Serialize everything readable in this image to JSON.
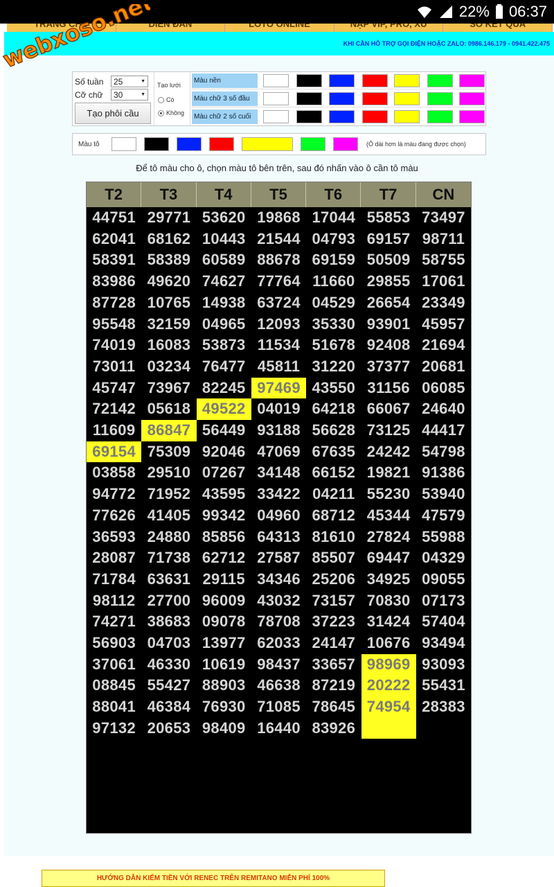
{
  "status_bar": {
    "battery": "22%",
    "time": "06:37",
    "wifi_icon": "wifi-icon",
    "signal_icon": "signal-icon",
    "battery_icon": "battery-icon"
  },
  "logo": {
    "text": "webxoso.net"
  },
  "nav": {
    "items": [
      "TRANG CHỦ",
      "DIỄN ĐÀN",
      "LOTO ONLINE",
      "NẠP VIP, PRO, XU",
      "SỔ KẾT QUẢ"
    ]
  },
  "support": {
    "text": "KHI CẦN HỖ TRỢ GỌI ĐIỆN HOẶC ZALO: 0986.146.179 - 0941.422.475"
  },
  "controls": {
    "so_tuan_label": "Số tuần",
    "so_tuan_value": "25",
    "co_chu_label": "Cỡ chữ",
    "co_chu_value": "30",
    "create_button": "Tạo phôi cầu",
    "grid_label": "Tạo lưới",
    "radio_yes": "Có",
    "radio_no": "Không",
    "rows": [
      {
        "label": "Màu nền"
      },
      {
        "label": "Màu chữ 3 số đầu"
      },
      {
        "label": "Màu chữ 2 số cuối"
      }
    ],
    "palette": [
      "#ffffff",
      "#000000",
      "#0022ff",
      "#ff0000",
      "#ffff00",
      "#00ff22",
      "#ff00ff"
    ]
  },
  "picker": {
    "label": "Màu tô",
    "colors": [
      "#ffffff",
      "#000000",
      "#0022ff",
      "#ff0000",
      "#ffff00",
      "#00ff22",
      "#ff00ff"
    ],
    "selected": "#ffff00",
    "note": "(Ô dài hơn là màu đang được chọn)"
  },
  "instruction": "Để tô màu cho ô, chọn màu tô bên trên, sau đó nhấn vào ô cần tô màu",
  "grid": {
    "headers": [
      "T2",
      "T3",
      "T4",
      "T5",
      "T6",
      "T7",
      "CN"
    ],
    "highlight_color": "#ffff22",
    "rows": [
      [
        "44751",
        "29771",
        "53620",
        "19868",
        "17044",
        "55853",
        "73497"
      ],
      [
        "62041",
        "68162",
        "10443",
        "21544",
        "04793",
        "69157",
        "98711"
      ],
      [
        "58391",
        "58389",
        "60589",
        "88678",
        "69159",
        "50509",
        "58755"
      ],
      [
        "83986",
        "49620",
        "74627",
        "77764",
        "11660",
        "29855",
        "17061"
      ],
      [
        "87728",
        "10765",
        "14938",
        "63724",
        "04529",
        "26654",
        "23349"
      ],
      [
        "95548",
        "32159",
        "04965",
        "12093",
        "35330",
        "93901",
        "45957"
      ],
      [
        "74019",
        "16083",
        "53873",
        "11534",
        "51678",
        "92408",
        "21694"
      ],
      [
        "73011",
        "03234",
        "76477",
        "45811",
        "31220",
        "37377",
        "20681"
      ],
      [
        "45747",
        "73967",
        "82245",
        "97469",
        "43550",
        "31156",
        "06085"
      ],
      [
        "72142",
        "05618",
        "49522",
        "04019",
        "64218",
        "66067",
        "24640"
      ],
      [
        "11609",
        "86847",
        "56449",
        "93188",
        "56628",
        "73125",
        "44417"
      ],
      [
        "69154",
        "75309",
        "92046",
        "47069",
        "67635",
        "24242",
        "54798"
      ],
      [
        "03858",
        "29510",
        "07267",
        "34148",
        "66152",
        "19821",
        "91386"
      ],
      [
        "94772",
        "71952",
        "43595",
        "33422",
        "04211",
        "55230",
        "53940"
      ],
      [
        "77626",
        "41405",
        "99342",
        "04960",
        "68712",
        "45344",
        "47579"
      ],
      [
        "36593",
        "24880",
        "85856",
        "64313",
        "81610",
        "27824",
        "55988"
      ],
      [
        "28087",
        "71738",
        "62712",
        "27587",
        "85507",
        "69447",
        "04329"
      ],
      [
        "71784",
        "63631",
        "29115",
        "34346",
        "25206",
        "34925",
        "09055"
      ],
      [
        "98112",
        "27700",
        "96009",
        "43032",
        "73157",
        "70830",
        "07173"
      ],
      [
        "74271",
        "38683",
        "09078",
        "78708",
        "37223",
        "31424",
        "57404"
      ],
      [
        "56903",
        "04703",
        "13977",
        "62033",
        "24147",
        "10676",
        "93494"
      ],
      [
        "37061",
        "46330",
        "10619",
        "98437",
        "33657",
        "98969",
        "93093"
      ],
      [
        "08845",
        "55427",
        "88903",
        "46638",
        "87219",
        "20222",
        "55431"
      ],
      [
        "88041",
        "46384",
        "76930",
        "71085",
        "78645",
        "74954",
        "28383"
      ],
      [
        "97132",
        "20653",
        "98409",
        "16440",
        "83926",
        "",
        ""
      ]
    ],
    "highlighted": [
      [
        8,
        3
      ],
      [
        9,
        2
      ],
      [
        10,
        1
      ],
      [
        11,
        0
      ],
      [
        21,
        5
      ],
      [
        22,
        5
      ],
      [
        23,
        5
      ],
      [
        24,
        5
      ]
    ]
  },
  "promo": {
    "text": "HƯỚNG DẪN KIẾM TIỀN VỚI RENEC TRÊN REMITANO MIỄN PHÍ 100%"
  }
}
